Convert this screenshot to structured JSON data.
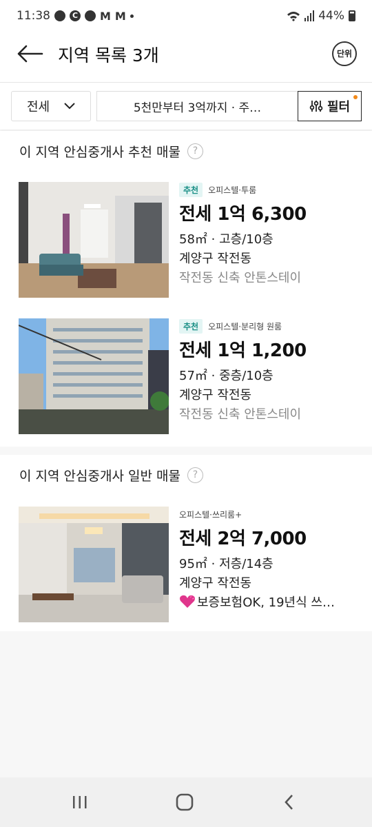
{
  "status": {
    "time": "11:38",
    "battery": "44%"
  },
  "header": {
    "title": "지역 목록 3개",
    "unit_label": "단위"
  },
  "filters": {
    "type_label": "전세",
    "range_label": "5천만부터 3억까지 · 주…",
    "filter_label": "필터"
  },
  "sections": [
    {
      "title": "이 지역 안심중개사 추천 매물",
      "help": "?",
      "items": [
        {
          "badge": "추천",
          "category": "오피스텔·투룸",
          "price": "전세 1억 6,300",
          "spec": "58㎡ · 고층/10층",
          "location": "계양구 작전동",
          "description": "작전동 신축 안톤스테이"
        },
        {
          "badge": "추천",
          "category": "오피스텔·분리형 원룸",
          "price": "전세 1억 1,200",
          "spec": "57㎡ · 중층/10층",
          "location": "계양구 작전동",
          "description": "작전동 신축 안톤스테이"
        }
      ]
    },
    {
      "title": "이 지역 안심중개사 일반 매물",
      "help": "?",
      "items": [
        {
          "badge": "",
          "category": "오피스텔·쓰리룸+",
          "price": "전세 2억 7,000",
          "spec": "95㎡ · 저층/14층",
          "location": "계양구 작전동",
          "description": "보증보험OK, 19년식 쓰…"
        }
      ]
    }
  ],
  "icons": {
    "back": "arrow-left-icon",
    "unit": "unit-toggle-icon",
    "filter": "sliders-icon",
    "chevron": "chevron-down-icon",
    "help": "question-circle-icon",
    "heart": "heart-icon",
    "nav_recent": "recents-icon",
    "nav_home": "home-icon",
    "nav_back": "nav-back-icon"
  },
  "colors": {
    "accent": "#1a8f86",
    "badge_bg": "#e3f5f4",
    "filter_dot": "#f28a1a",
    "heart": "#e0368c"
  }
}
